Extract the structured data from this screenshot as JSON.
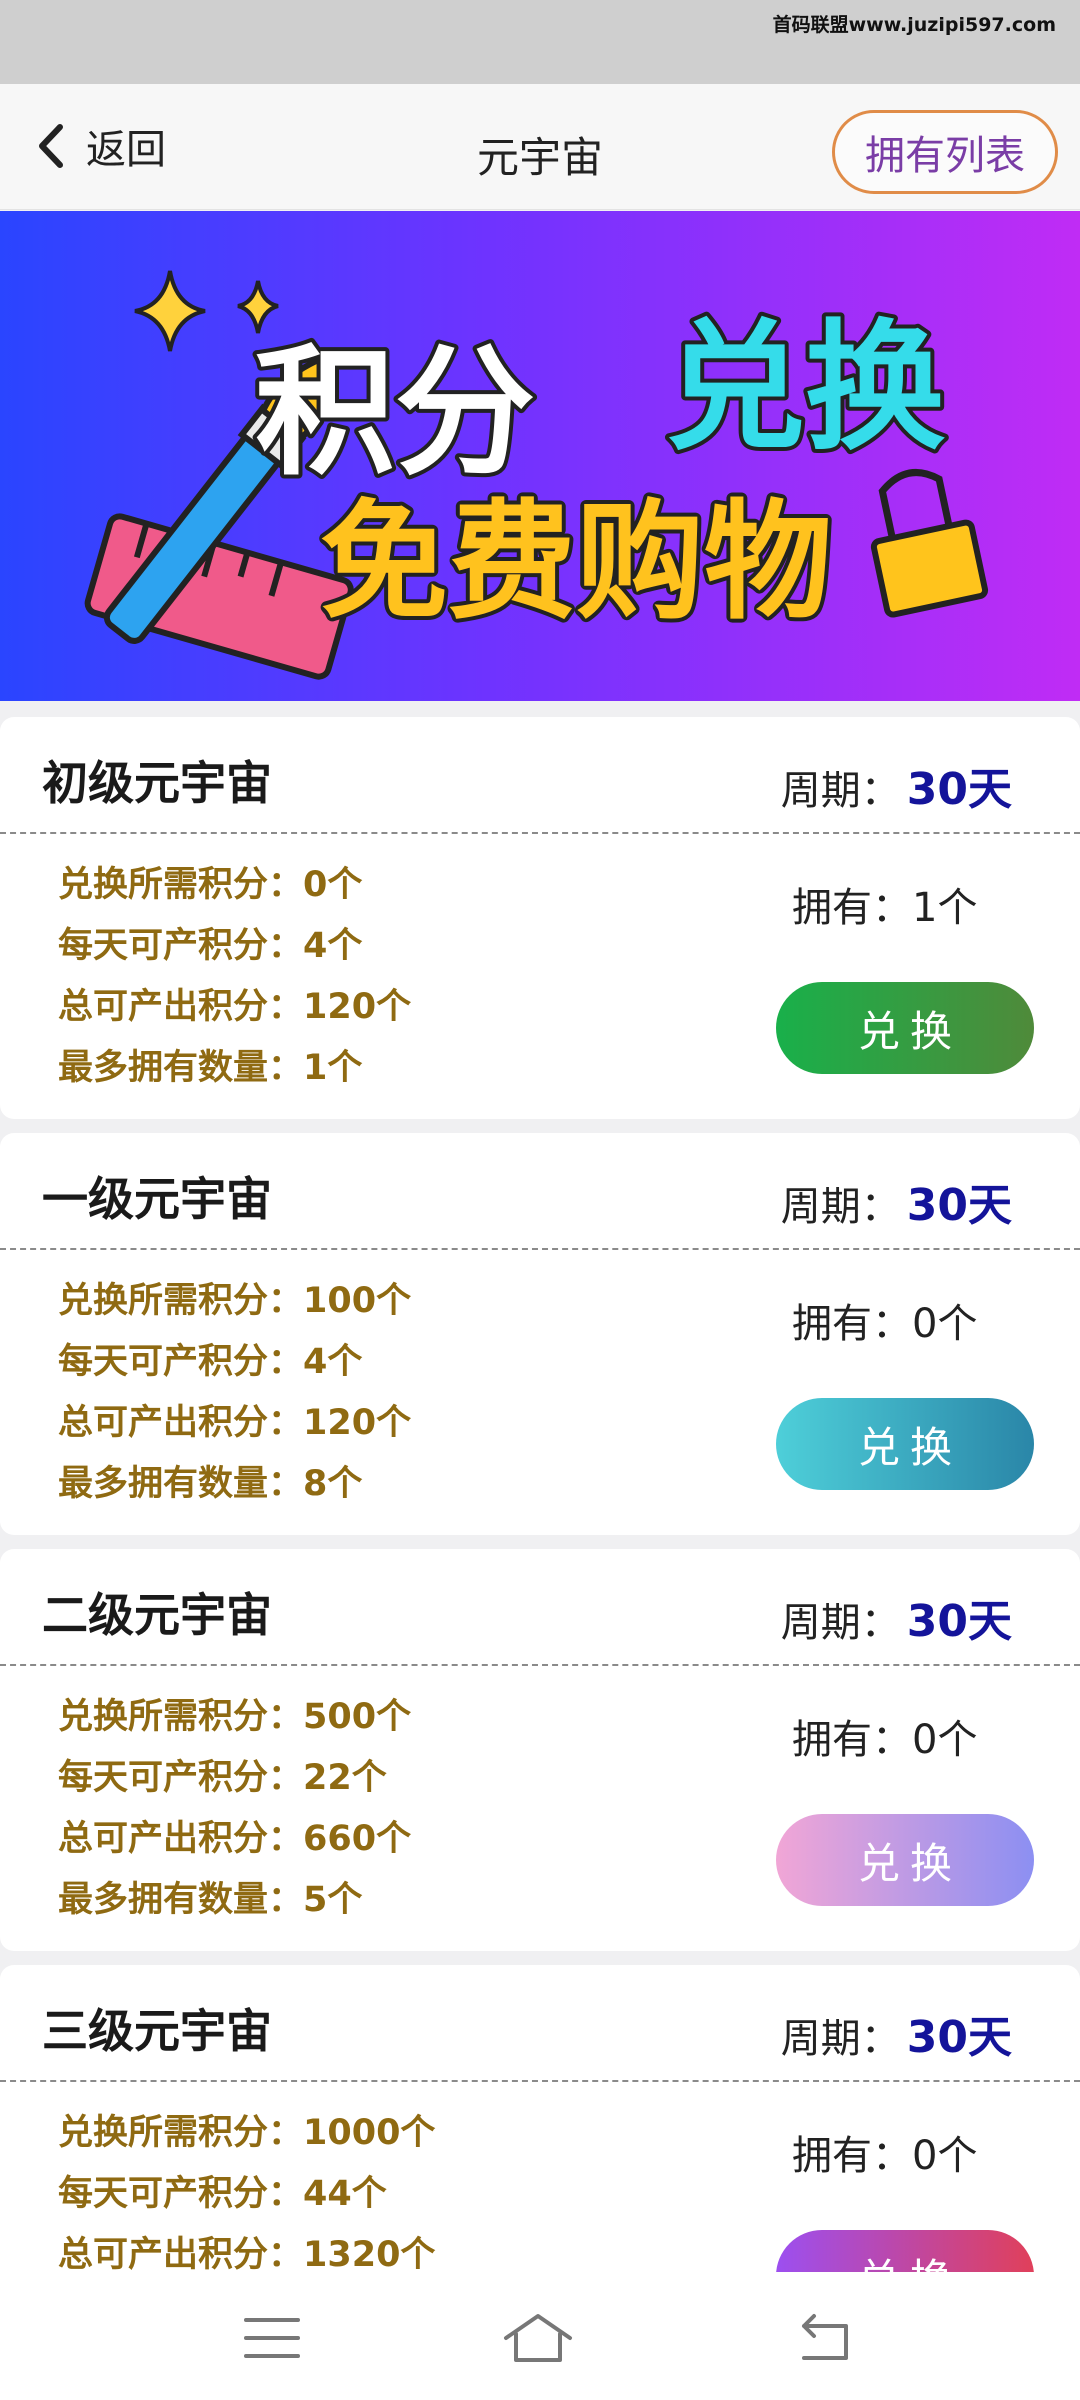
{
  "status_bar": {
    "watermark": "首码联盟www.juzipi597.com"
  },
  "nav": {
    "back_label": "返回",
    "title": "元宇宙",
    "owned_list_label": "拥有列表"
  },
  "banner": {
    "line1_white": "积分",
    "line1_cyan": "兑换",
    "line2": "免费购物"
  },
  "labels": {
    "period_prefix": "周期：",
    "owned_prefix": "拥有：",
    "cost_prefix": "兑换所需积分：",
    "daily_prefix": "每天可产积分：",
    "total_prefix": "总可产出积分：",
    "max_prefix": "最多拥有数量："
  },
  "cards": [
    {
      "title": "初级元宇宙",
      "period": "30天",
      "owned": "1个",
      "cost": "0个",
      "daily": "4个",
      "total": "120个",
      "max": "1个",
      "button": "兑换",
      "button_gradient": [
        "#19b04a",
        "#4f8a3a"
      ]
    },
    {
      "title": "一级元宇宙",
      "period": "30天",
      "owned": "0个",
      "cost": "100个",
      "daily": "4个",
      "total": "120个",
      "max": "8个",
      "button": "兑换",
      "button_gradient": [
        "#4ecfd9",
        "#2a86a8"
      ]
    },
    {
      "title": "二级元宇宙",
      "period": "30天",
      "owned": "0个",
      "cost": "500个",
      "daily": "22个",
      "total": "660个",
      "max": "5个",
      "button": "兑换",
      "button_gradient": [
        "#f1a6d6",
        "#8c8ff2"
      ]
    },
    {
      "title": "三级元宇宙",
      "period": "30天",
      "owned": "0个",
      "cost": "1000个",
      "daily": "44个",
      "total": "1320个",
      "max": "",
      "button": "兑换",
      "button_gradient": [
        "#9c4ff0",
        "#e0405a"
      ]
    }
  ],
  "bottom_nav": {
    "icons": [
      "menu-icon",
      "home-icon",
      "back-icon"
    ]
  }
}
